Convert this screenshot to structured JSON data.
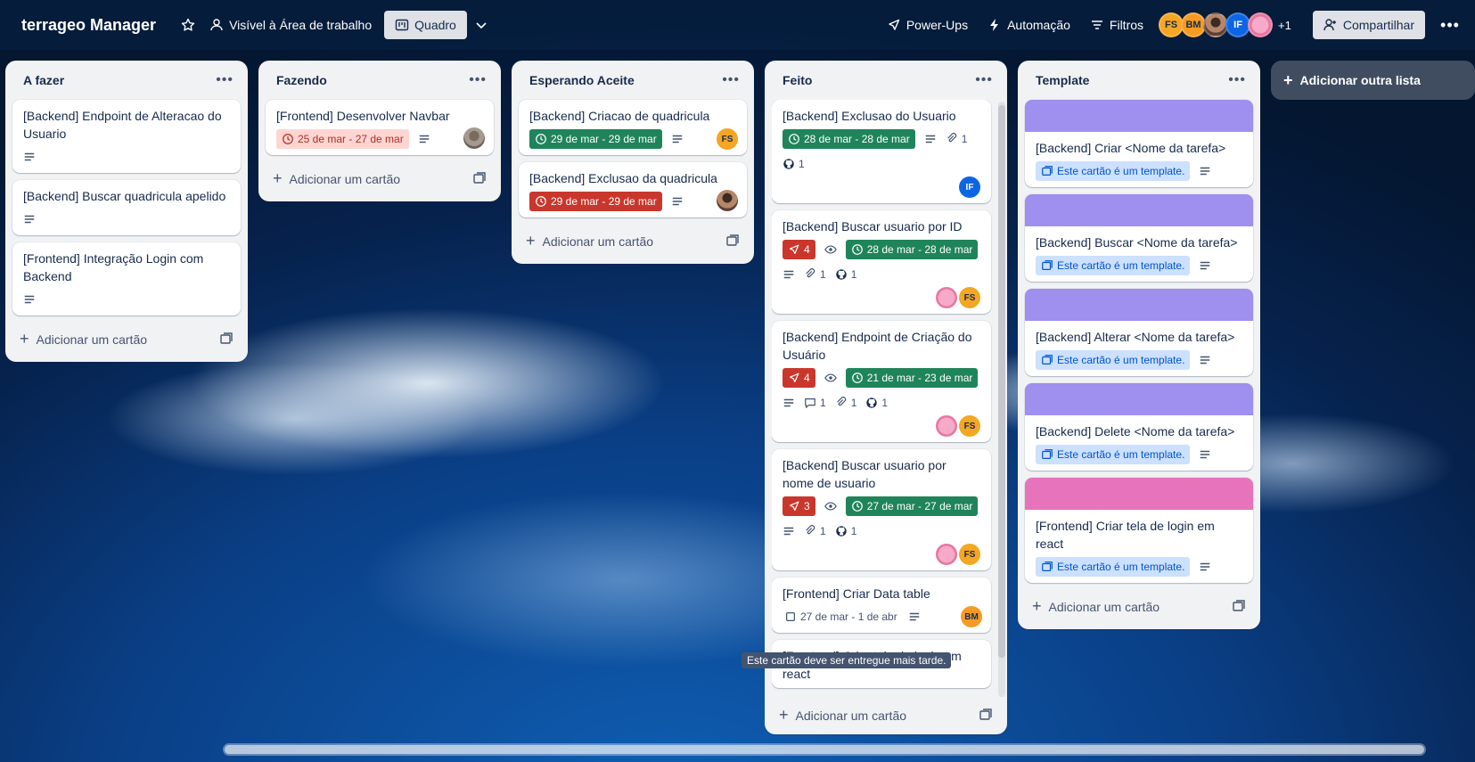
{
  "header": {
    "board_title": "terrageo Manager",
    "visibility_label": "Visível à Área de trabalho",
    "view_label": "Quadro",
    "powerups_label": "Power-Ups",
    "automation_label": "Automação",
    "filters_label": "Filtros",
    "members": [
      "FS",
      "BM",
      "",
      "IF",
      ""
    ],
    "more_members": "+1",
    "share_label": "Compartilhar"
  },
  "lists": {
    "afazer": {
      "title": "A fazer",
      "cards": [
        {
          "title": "[Backend] Endpoint de Alteracao do Usuario"
        },
        {
          "title": "[Backend] Buscar quadricula apelido"
        },
        {
          "title": "[Frontend] Integração Login com Backend"
        }
      ],
      "add_card_label": "Adicionar um cartão"
    },
    "fazendo": {
      "title": "Fazendo",
      "cards": [
        {
          "title": "[Frontend] Desenvolver Navbar",
          "due": "25 de mar - 27 de mar"
        }
      ],
      "add_card_label": "Adicionar um cartão"
    },
    "esperando": {
      "title": "Esperando Aceite",
      "cards": [
        {
          "title": "[Backend] Criacao de quadricula",
          "due": "29 de mar - 29 de mar",
          "member": "FS"
        },
        {
          "title": "[Backend] Exclusao da quadricula",
          "due": "29 de mar - 29 de mar"
        }
      ],
      "add_card_label": "Adicionar um cartão"
    },
    "feito": {
      "title": "Feito",
      "cards": [
        {
          "title": "[Backend] Exclusao do Usuario",
          "due": "28 de mar - 28 de mar",
          "attachments": "1",
          "github": "1",
          "member": "IF"
        },
        {
          "title": "[Backend] Buscar usuario por ID",
          "votes": "4",
          "due": "28 de mar - 28 de mar",
          "attachments": "1",
          "github": "1",
          "member": "FS"
        },
        {
          "title": "[Backend] Endpoint de Criação do Usuário",
          "votes": "4",
          "due": "21 de mar - 23 de mar",
          "comments": "1",
          "attachments": "1",
          "github": "1",
          "member": "FS"
        },
        {
          "title": "[Backend] Buscar usuario por nome de usuario",
          "votes": "3",
          "due": "27 de mar - 27 de mar",
          "attachments": "1",
          "github": "1",
          "member": "FS"
        },
        {
          "title": "[Frontend] Criar Data table",
          "due": "27 de mar - 1 de abr",
          "member": "BM"
        },
        {
          "title": "[Frontend] Criar tela de login em react"
        }
      ],
      "add_card_label": "Adicionar um cartão"
    },
    "template": {
      "title": "Template",
      "template_badge": "Este cartão é um template.",
      "cards": [
        {
          "title": "[Backend] Criar <Nome da tarefa>",
          "cover": "#9f8fef"
        },
        {
          "title": "[Backend] Buscar <Nome da tarefa>",
          "cover": "#9f8fef"
        },
        {
          "title": "[Backend] Alterar <Nome da tarefa>",
          "cover": "#9f8fef"
        },
        {
          "title": "[Backend] Delete <Nome da tarefa>",
          "cover": "#9f8fef"
        },
        {
          "title": "[Frontend] Criar tela de login em react",
          "cover": "#e774bb"
        }
      ],
      "add_card_label": "Adicionar um cartão"
    }
  },
  "add_list_label": "Adicionar outra lista",
  "tooltip": "Este cartão deve ser entregue mais tarde."
}
